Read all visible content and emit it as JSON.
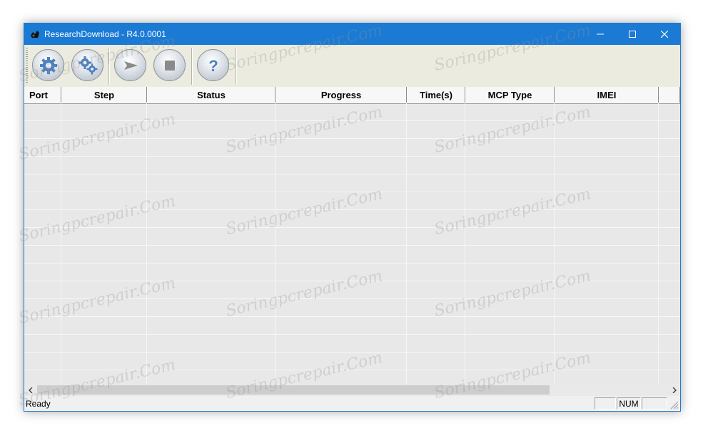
{
  "window": {
    "title": "ResearchDownload - R4.0.0001"
  },
  "toolbar": {
    "buttons": [
      {
        "name": "load-packet",
        "icon": "gear-icon"
      },
      {
        "name": "settings",
        "icon": "gears-icon"
      },
      {
        "name": "start",
        "icon": "play-arrow-icon"
      },
      {
        "name": "stop",
        "icon": "stop-square-icon"
      },
      {
        "name": "about",
        "icon": "question-icon"
      }
    ]
  },
  "grid": {
    "columns": [
      "Port",
      "Step",
      "Status",
      "Progress",
      "Time(s)",
      "MCP Type",
      "IMEI",
      ""
    ],
    "rows": []
  },
  "statusbar": {
    "text": "Ready",
    "panel1": "",
    "panel2": "NUM",
    "panel3": ""
  },
  "watermark": {
    "text": "Soringpcrepair.Com"
  },
  "colors": {
    "titlebar": "#1a7ad4",
    "toolbar": "#ecebdf",
    "grid_bg": "#e8e8e8"
  }
}
